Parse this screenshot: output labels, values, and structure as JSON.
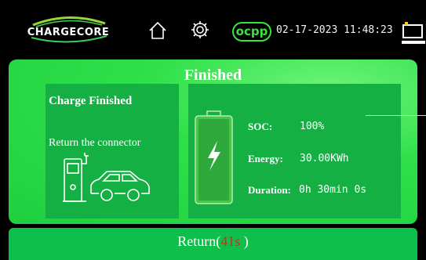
{
  "header": {
    "brand": "CHARGECORE",
    "protocol_badge": "ocpp",
    "datetime": "02-17-2023 11:48:23"
  },
  "panel": {
    "title": "Finished"
  },
  "status_card": {
    "title": "Charge Finished",
    "instruction": "Return the connector"
  },
  "summary": {
    "soc_label": "SOC:",
    "soc_value": "100%",
    "energy_label": "Energy:",
    "energy_value": "30.00KWh",
    "duration_label": "Duration:",
    "duration_value": "0h 30min 0s"
  },
  "footer": {
    "return_prefix": "Return(",
    "countdown": "41s",
    "return_suffix": " )"
  },
  "colors": {
    "panel_green": "#2fe04a",
    "card_green": "#14b043",
    "ocpp_green": "#35e63a",
    "countdown_red": "#d12a1f"
  },
  "icons": [
    "home-icon",
    "gear-icon",
    "network-icon",
    "battery-icon",
    "lightning-icon",
    "charger-station-icon",
    "car-icon"
  ]
}
